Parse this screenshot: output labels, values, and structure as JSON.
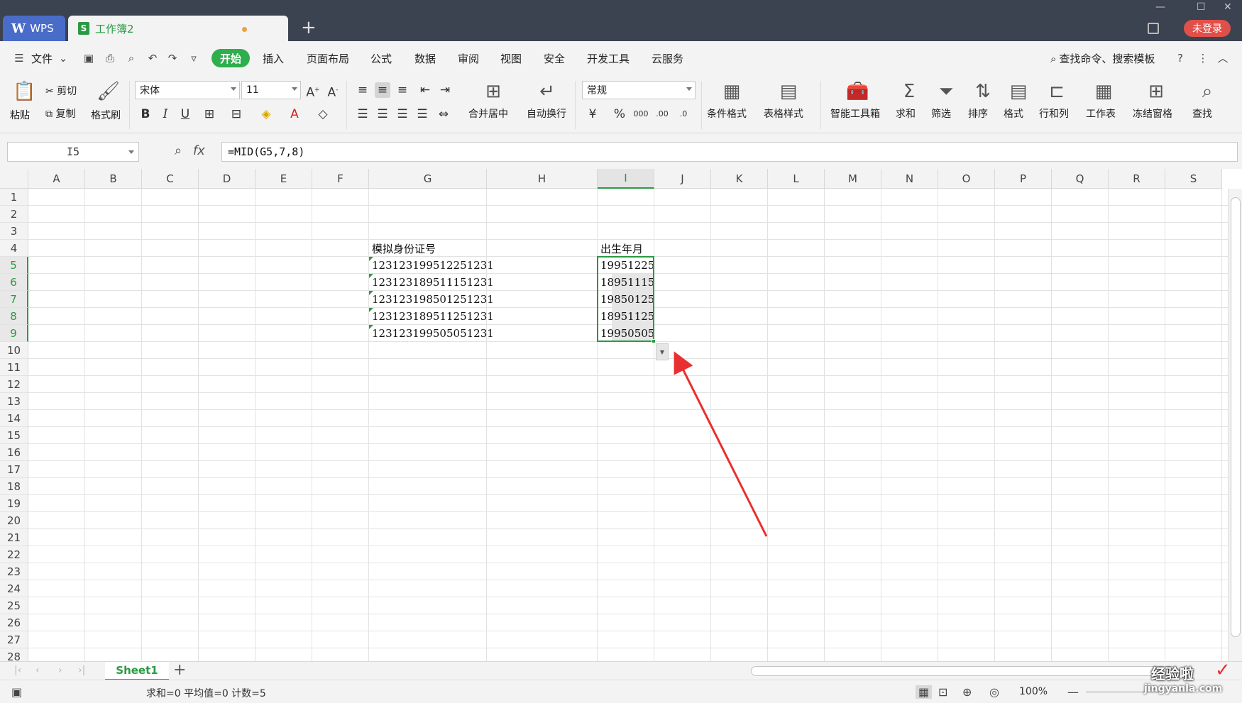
{
  "titlebar": {
    "wps_label": "WPS",
    "doc_tab_label": "工作簿2",
    "doc_icon_letter": "S",
    "new_tab": "+",
    "login_label": "未登录"
  },
  "menubar": {
    "file_label": "文件",
    "items": [
      "开始",
      "插入",
      "页面布局",
      "公式",
      "数据",
      "审阅",
      "视图",
      "安全",
      "开发工具",
      "云服务"
    ],
    "search_label": "查找命令、搜索模板"
  },
  "ribbon": {
    "paste": "粘贴",
    "cut": "剪切",
    "copy": "复制",
    "format_painter": "格式刷",
    "font_name": "宋体",
    "font_size": "11",
    "bold": "B",
    "italic": "I",
    "underline": "U",
    "merge_center": "合并居中",
    "wrap_text": "自动换行",
    "number_format": "常规",
    "conditional_format": "条件格式",
    "table_style": "表格样式",
    "smart_toolbox": "智能工具箱",
    "sum": "求和",
    "filter": "筛选",
    "sort": "排序",
    "format": "格式",
    "rows_cols": "行和列",
    "worksheet": "工作表",
    "freeze_panes": "冻结窗格",
    "find": "查找"
  },
  "formula_bar": {
    "name_box": "I5",
    "fx": "fx",
    "formula": "=MID(G5,7,8)"
  },
  "grid": {
    "columns": [
      "A",
      "B",
      "C",
      "D",
      "E",
      "F",
      "G",
      "H",
      "I",
      "J",
      "K",
      "L",
      "M",
      "N",
      "O",
      "P",
      "Q",
      "R",
      "S"
    ],
    "selected_column": "I",
    "rows": [
      "1",
      "2",
      "3",
      "4",
      "5",
      "6",
      "7",
      "8",
      "9",
      "10",
      "11",
      "12",
      "13",
      "14",
      "15",
      "16",
      "17",
      "18",
      "19",
      "20",
      "21",
      "22",
      "23",
      "24",
      "25",
      "26",
      "27",
      "28"
    ],
    "selected_rows": [
      "5",
      "6",
      "7",
      "8",
      "9"
    ],
    "header_g": "模拟身份证号",
    "header_i": "出生年月",
    "id_numbers": [
      "123123199512251231",
      "123123189511151231",
      "123123198501251231",
      "123123189511251231",
      "123123199505051231"
    ],
    "birth_dates": [
      "19951225",
      "18951115",
      "19850125",
      "18951125",
      "19950505"
    ]
  },
  "sheetbar": {
    "sheet_name": "Sheet1",
    "add_sheet": "+"
  },
  "statusbar": {
    "summary": "求和=0  平均值=0  计数=5",
    "zoom": "100%"
  },
  "watermark": {
    "text": "经验啦",
    "url": "jingyanla.com",
    "check": "✓"
  },
  "colors": {
    "accent_green": "#2a9a42",
    "annotation_arrow": "#e83030",
    "login_red": "#e0504a"
  }
}
